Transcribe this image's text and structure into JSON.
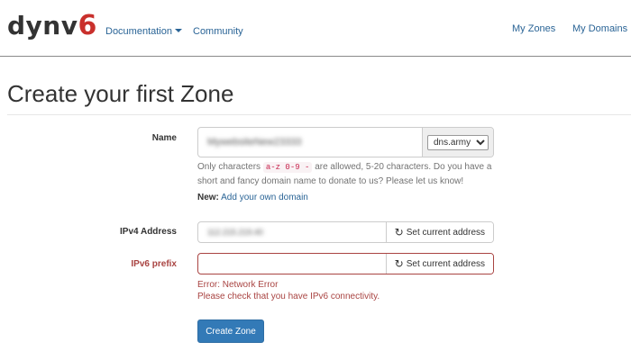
{
  "nav": {
    "logo_main": "dynv",
    "logo_six": "6",
    "links": {
      "documentation": "Documentation",
      "community": "Community",
      "my_zones": "My Zones",
      "my_domains": "My Domains"
    }
  },
  "page": {
    "title": "Create your first Zone"
  },
  "form": {
    "name": {
      "label": "Name",
      "value": "MywebsiteNew23333",
      "zone_options": [
        "dns.army"
      ],
      "zone_selected": "dns.army",
      "help_before": "Only characters ",
      "allowed_chars": "a-z 0-9 -",
      "help_after": " are allowed, 5-20 characters. Do you have a short and fancy domain name to donate to us? Please let us know!",
      "new_prefix": "New:",
      "new_link": "Add your own domain"
    },
    "ipv4": {
      "label": "IPv4 Address",
      "value": "112.215.219.40",
      "button": "Set current address"
    },
    "ipv6": {
      "label": "IPv6 prefix",
      "value": "",
      "button": "Set current address",
      "error_line1": "Error: Network Error",
      "error_line2": "Please check that you have IPv6 connectivity."
    },
    "submit": "Create Zone"
  },
  "colors": {
    "link": "#2a6496",
    "error": "#a94442",
    "primary": "#337ab7",
    "logo_accent": "#c9302c"
  },
  "icons": {
    "refresh": "refresh-icon",
    "dropdown": "caret-down-icon"
  }
}
